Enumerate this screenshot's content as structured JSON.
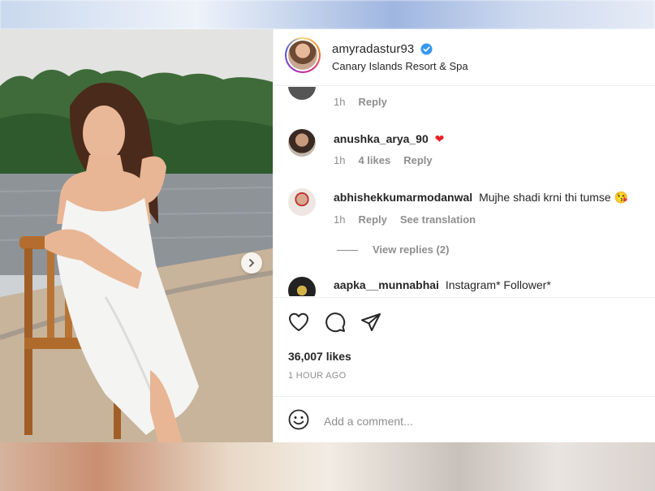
{
  "post": {
    "username": "amyradastur93",
    "location": "Canary Islands Resort & Spa"
  },
  "comments": [
    {
      "time": "1h",
      "reply": "Reply"
    },
    {
      "username": "anushka_arya_90",
      "text": "❤",
      "time": "1h",
      "likes": "4 likes",
      "reply": "Reply"
    },
    {
      "username": "abhishekkumarmodanwal",
      "text": "Mujhe shadi krni thi tumse",
      "emoji": "😘",
      "time": "1h",
      "reply": "Reply",
      "translation": "See translation",
      "view_replies": "View replies (2)"
    },
    {
      "username": "aapka__munnabhai",
      "text": "Instagram* Follower*"
    }
  ],
  "stats": {
    "likes": "36,007 likes",
    "time_ago": "1 HOUR AGO"
  },
  "composer": {
    "placeholder": "Add a comment..."
  },
  "icons": [
    "verified-badge-icon",
    "heart-icon",
    "comment-icon",
    "share-icon",
    "emoji-icon",
    "chevron-right-icon"
  ],
  "colors": {
    "verified": "#3897f0",
    "text": "#262626",
    "muted": "#8e8e8e",
    "heart_emoji": "#ed1c24"
  },
  "carousel": {
    "slides": 3,
    "active": 1
  }
}
